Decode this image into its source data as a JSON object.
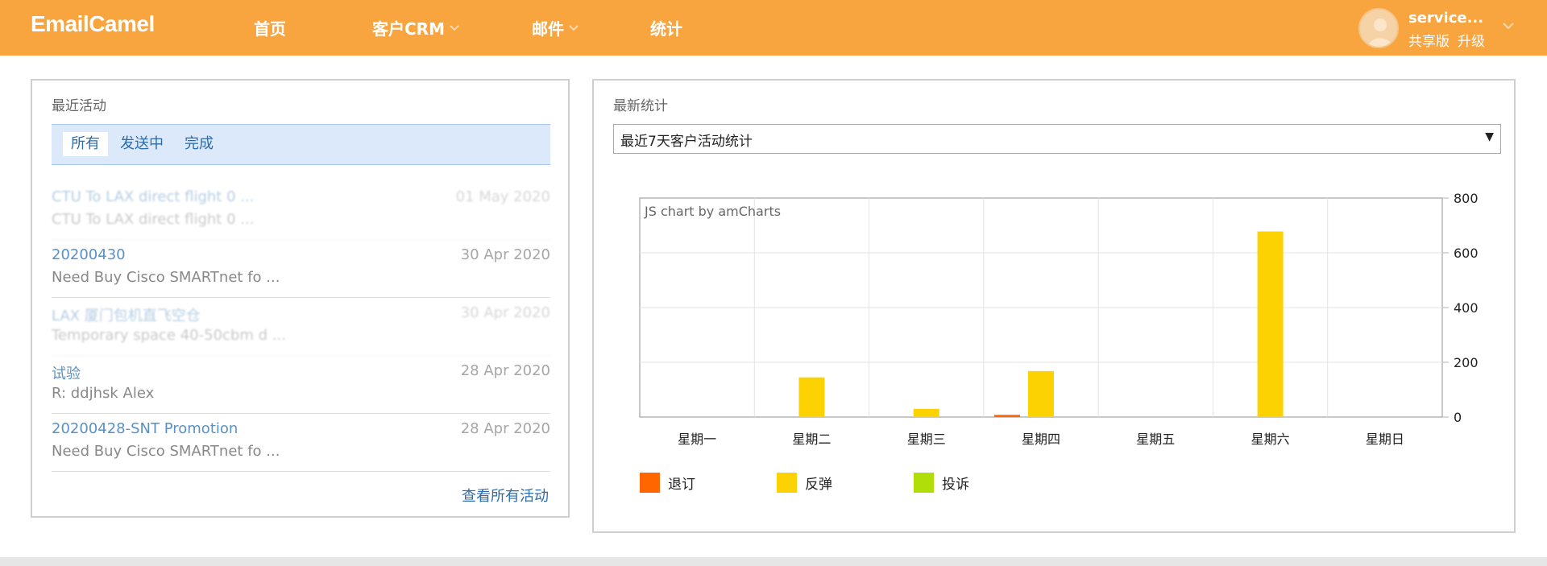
{
  "header": {
    "brand": "EmailCamel",
    "nav": [
      {
        "label": "首页",
        "dropdown": false
      },
      {
        "label": "客户CRM",
        "dropdown": true
      },
      {
        "label": "邮件",
        "dropdown": true
      },
      {
        "label": "统计",
        "dropdown": false
      }
    ],
    "user": {
      "name": "service...",
      "plan": "共享版",
      "upgrade": "升级"
    }
  },
  "recent_activity": {
    "title": "最近活动",
    "tabs": [
      "所有",
      "发送中",
      "完成"
    ],
    "active_tab": "所有",
    "items": [
      {
        "title": "CTU To LAX direct flight 0 ...",
        "date": "01 May 2020",
        "subtitle": "CTU To LAX direct flight 0 ..."
      },
      {
        "title": "20200430",
        "date": "30 Apr 2020",
        "subtitle": "Need Buy Cisco SMARTnet fo ..."
      },
      {
        "title": "LAX 厦门包机直飞空仓",
        "date": "30 Apr 2020",
        "subtitle": "Temporary space 40-50cbm d ..."
      },
      {
        "title": "试验",
        "date": "28 Apr 2020",
        "subtitle": "R: ddjhsk Alex"
      },
      {
        "title": "20200428-SNT Promotion",
        "date": "28 Apr 2020",
        "subtitle": "Need Buy Cisco SMARTnet fo ..."
      }
    ],
    "view_all": "查看所有活动"
  },
  "latest_stats": {
    "title": "最新统计",
    "select_value": "最近7天客户活动统计",
    "select_arrow": "▼"
  },
  "chart_data": {
    "type": "bar",
    "watermark": "JS chart by amCharts",
    "categories": [
      "星期一",
      "星期二",
      "星期三",
      "星期四",
      "星期五",
      "星期六",
      "星期日"
    ],
    "series": [
      {
        "name": "退订",
        "color": "#ff6600",
        "values": [
          0,
          0,
          0,
          8,
          0,
          0,
          0
        ]
      },
      {
        "name": "反弹",
        "color": "#fcd202",
        "values": [
          0,
          145,
          30,
          168,
          0,
          678,
          0
        ]
      },
      {
        "name": "投诉",
        "color": "#b0de09",
        "values": [
          0,
          0,
          0,
          0,
          0,
          0,
          0
        ]
      }
    ],
    "yaxis": {
      "min": 0,
      "max": 800,
      "ticks": [
        0,
        200,
        400,
        600,
        800
      ],
      "position": "right"
    },
    "grid": true,
    "legend": "bottom-left"
  }
}
